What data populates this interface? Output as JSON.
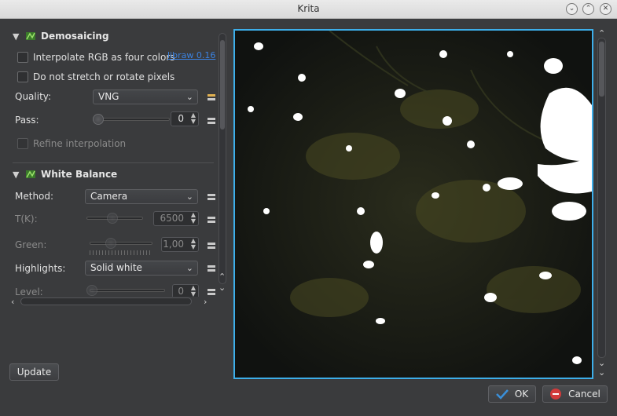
{
  "window": {
    "title": "Krita"
  },
  "demosaicing": {
    "header": "Demosaicing",
    "interpolate_label": "Interpolate RGB as four colors",
    "link_label": "libraw 0.16",
    "nostretch_label": "Do not stretch or rotate pixels",
    "quality_label": "Quality:",
    "quality_value": "VNG",
    "pass_label": "Pass:",
    "pass_value": "0",
    "refine_label": "Refine interpolation"
  },
  "white_balance": {
    "header": "White Balance",
    "method_label": "Method:",
    "method_value": "Camera",
    "tk_label": "T(K):",
    "tk_value": "6500",
    "green_label": "Green:",
    "green_value": "1,00",
    "highlights_label": "Highlights:",
    "highlights_value": "Solid white",
    "level_label": "Level:",
    "level_value": "0"
  },
  "buttons": {
    "update": "Update",
    "ok": "OK",
    "cancel": "Cancel"
  },
  "colors": {
    "accent": "#3daee9",
    "cancel_icon": "#d13a3a",
    "ok_icon": "#3a8fd9"
  }
}
